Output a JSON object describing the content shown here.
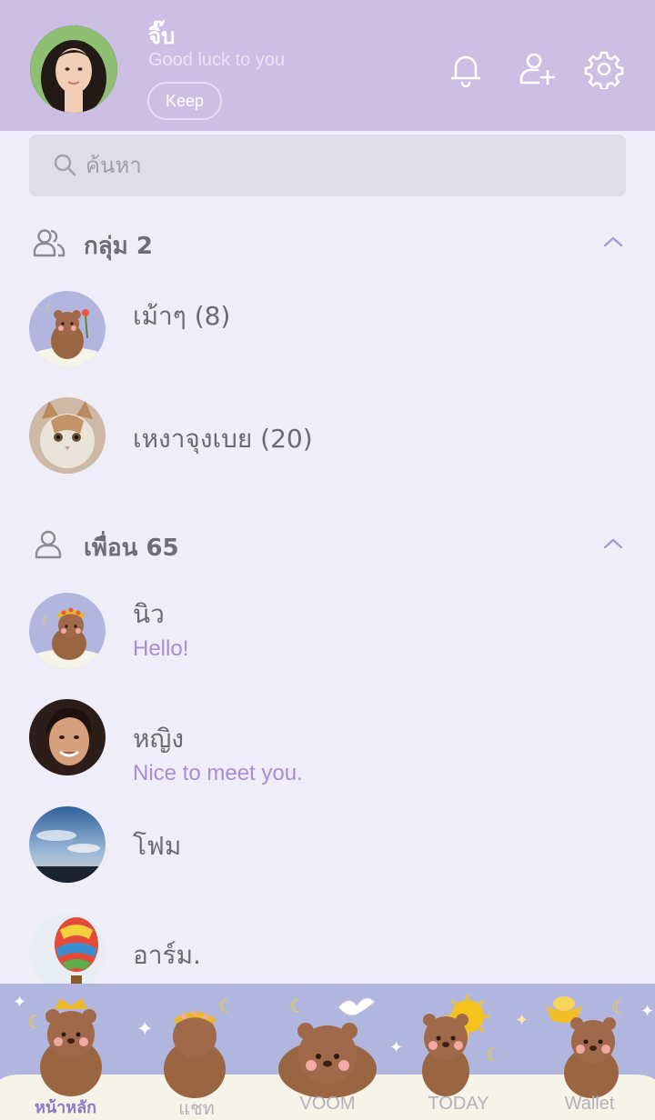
{
  "profile": {
    "name": "จิ๊บ",
    "status": "Good luck to you",
    "keep_label": "Keep"
  },
  "header_icons": [
    "bell-icon",
    "add-friend-icon",
    "gear-icon"
  ],
  "search": {
    "placeholder": "ค้นหา"
  },
  "groups": {
    "title": "กลุ่ม 2",
    "items": [
      {
        "name": "เม้าๆ (8)"
      },
      {
        "name": "เหงาจุงเบย (20)"
      }
    ]
  },
  "friends": {
    "title": "เพื่อน 65",
    "items": [
      {
        "name": "นิว",
        "message": "Hello!"
      },
      {
        "name": "หญิง",
        "message": "Nice to meet you."
      },
      {
        "name": "โฟม",
        "message": ""
      },
      {
        "name": "อาร์ม.",
        "message": ""
      }
    ]
  },
  "nav": [
    {
      "label": "หน้าหลัก",
      "active": true
    },
    {
      "label": "แชท",
      "active": false
    },
    {
      "label": "VOOM",
      "active": false
    },
    {
      "label": "TODAY",
      "active": false
    },
    {
      "label": "Wallet",
      "active": false
    }
  ],
  "colors": {
    "header_bg": "#CDBFE3",
    "page_bg": "#EFEDF7",
    "accent": "#A98ED3",
    "nav_bg": "#B0B6DD"
  }
}
